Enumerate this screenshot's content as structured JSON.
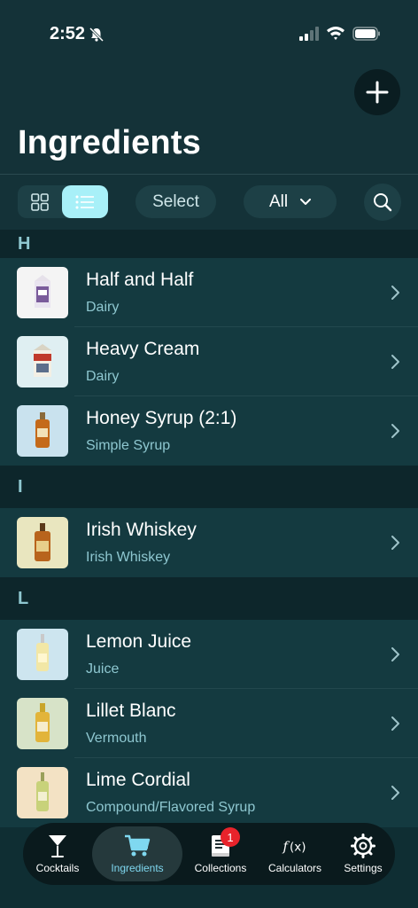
{
  "status_bar": {
    "time": "2:52"
  },
  "header": {
    "title": "Ingredients"
  },
  "toolbar": {
    "select_label": "Select",
    "filter_label": "All"
  },
  "sections": [
    {
      "letter": "H",
      "items": [
        {
          "name": "Half and Half",
          "category": "Dairy"
        },
        {
          "name": "Heavy Cream",
          "category": "Dairy"
        },
        {
          "name": "Honey Syrup (2:1)",
          "category": "Simple Syrup"
        }
      ]
    },
    {
      "letter": "I",
      "items": [
        {
          "name": "Irish Whiskey",
          "category": "Irish Whiskey"
        }
      ]
    },
    {
      "letter": "L",
      "items": [
        {
          "name": "Lemon Juice",
          "category": "Juice"
        },
        {
          "name": "Lillet Blanc",
          "category": "Vermouth"
        },
        {
          "name": "Lime Cordial",
          "category": "Compound/Flavored Syrup"
        }
      ]
    }
  ],
  "tabbar": {
    "tabs": [
      {
        "label": "Cocktails"
      },
      {
        "label": "Ingredients"
      },
      {
        "label": "Collections",
        "badge": "1"
      },
      {
        "label": "Calculators"
      },
      {
        "label": "Settings"
      }
    ]
  },
  "colors": {
    "background": "#0f2e33",
    "accent": "#a8f0f8",
    "active_tab": "#7fd8f0",
    "badge": "#e8232b"
  }
}
